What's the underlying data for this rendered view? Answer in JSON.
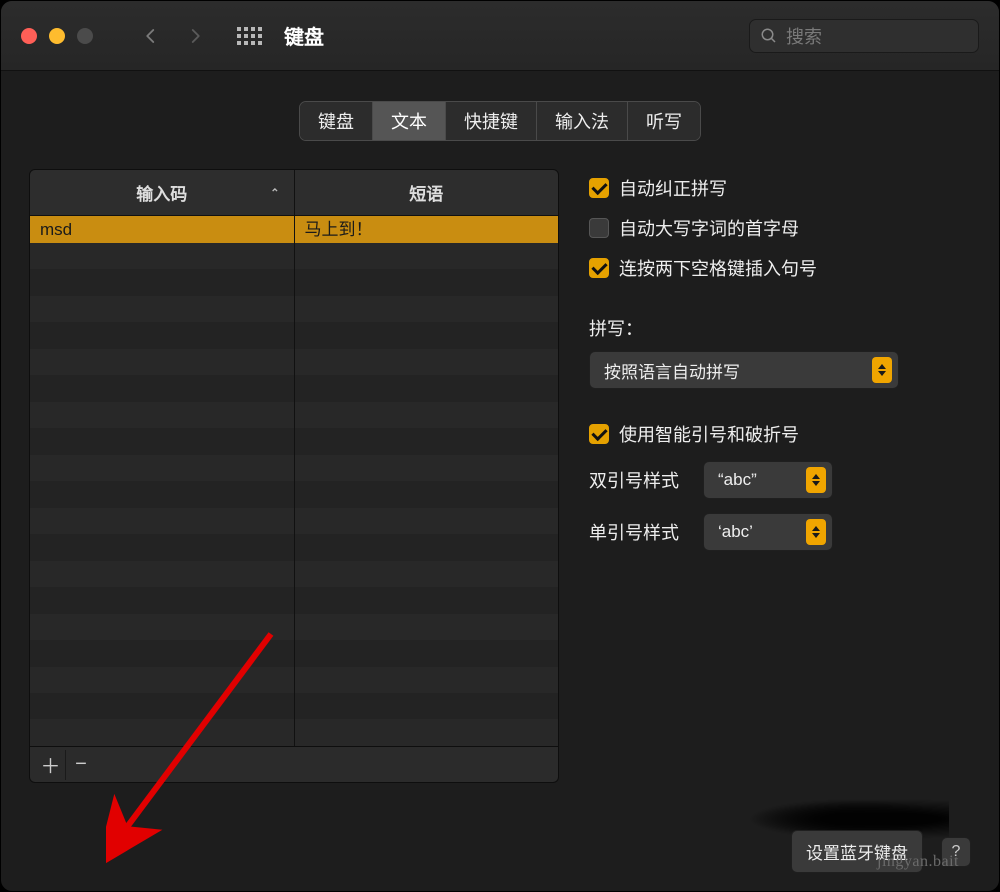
{
  "header": {
    "title": "键盘",
    "search_placeholder": "搜索"
  },
  "tabs": [
    {
      "id": "keyboard",
      "label": "键盘",
      "active": false
    },
    {
      "id": "text",
      "label": "文本",
      "active": true
    },
    {
      "id": "shortcuts",
      "label": "快捷键",
      "active": false
    },
    {
      "id": "input",
      "label": "输入法",
      "active": false
    },
    {
      "id": "dictation",
      "label": "听写",
      "active": false
    }
  ],
  "table": {
    "columns": {
      "code": "输入码",
      "phrase": "短语"
    },
    "rows": [
      {
        "code": "msd",
        "phrase": "马上到！",
        "selected": true
      }
    ],
    "empty_rows": 19
  },
  "options": {
    "auto_correct": {
      "checked": true,
      "label": "自动纠正拼写"
    },
    "auto_cap": {
      "checked": false,
      "label": "自动大写字词的首字母"
    },
    "double_space": {
      "checked": true,
      "label": "连按两下空格键插入句号"
    },
    "spelling_label": "拼写：",
    "spelling_value": "按照语言自动拼写",
    "smart_quotes": {
      "checked": true,
      "label": "使用智能引号和破折号"
    },
    "double_quote": {
      "label": "双引号样式",
      "value": "“abc”"
    },
    "single_quote": {
      "label": "单引号样式",
      "value": "‘abc’"
    }
  },
  "footer": {
    "bluetooth_btn": "设置蓝牙键盘"
  },
  "watermark": "jingyan.bait"
}
